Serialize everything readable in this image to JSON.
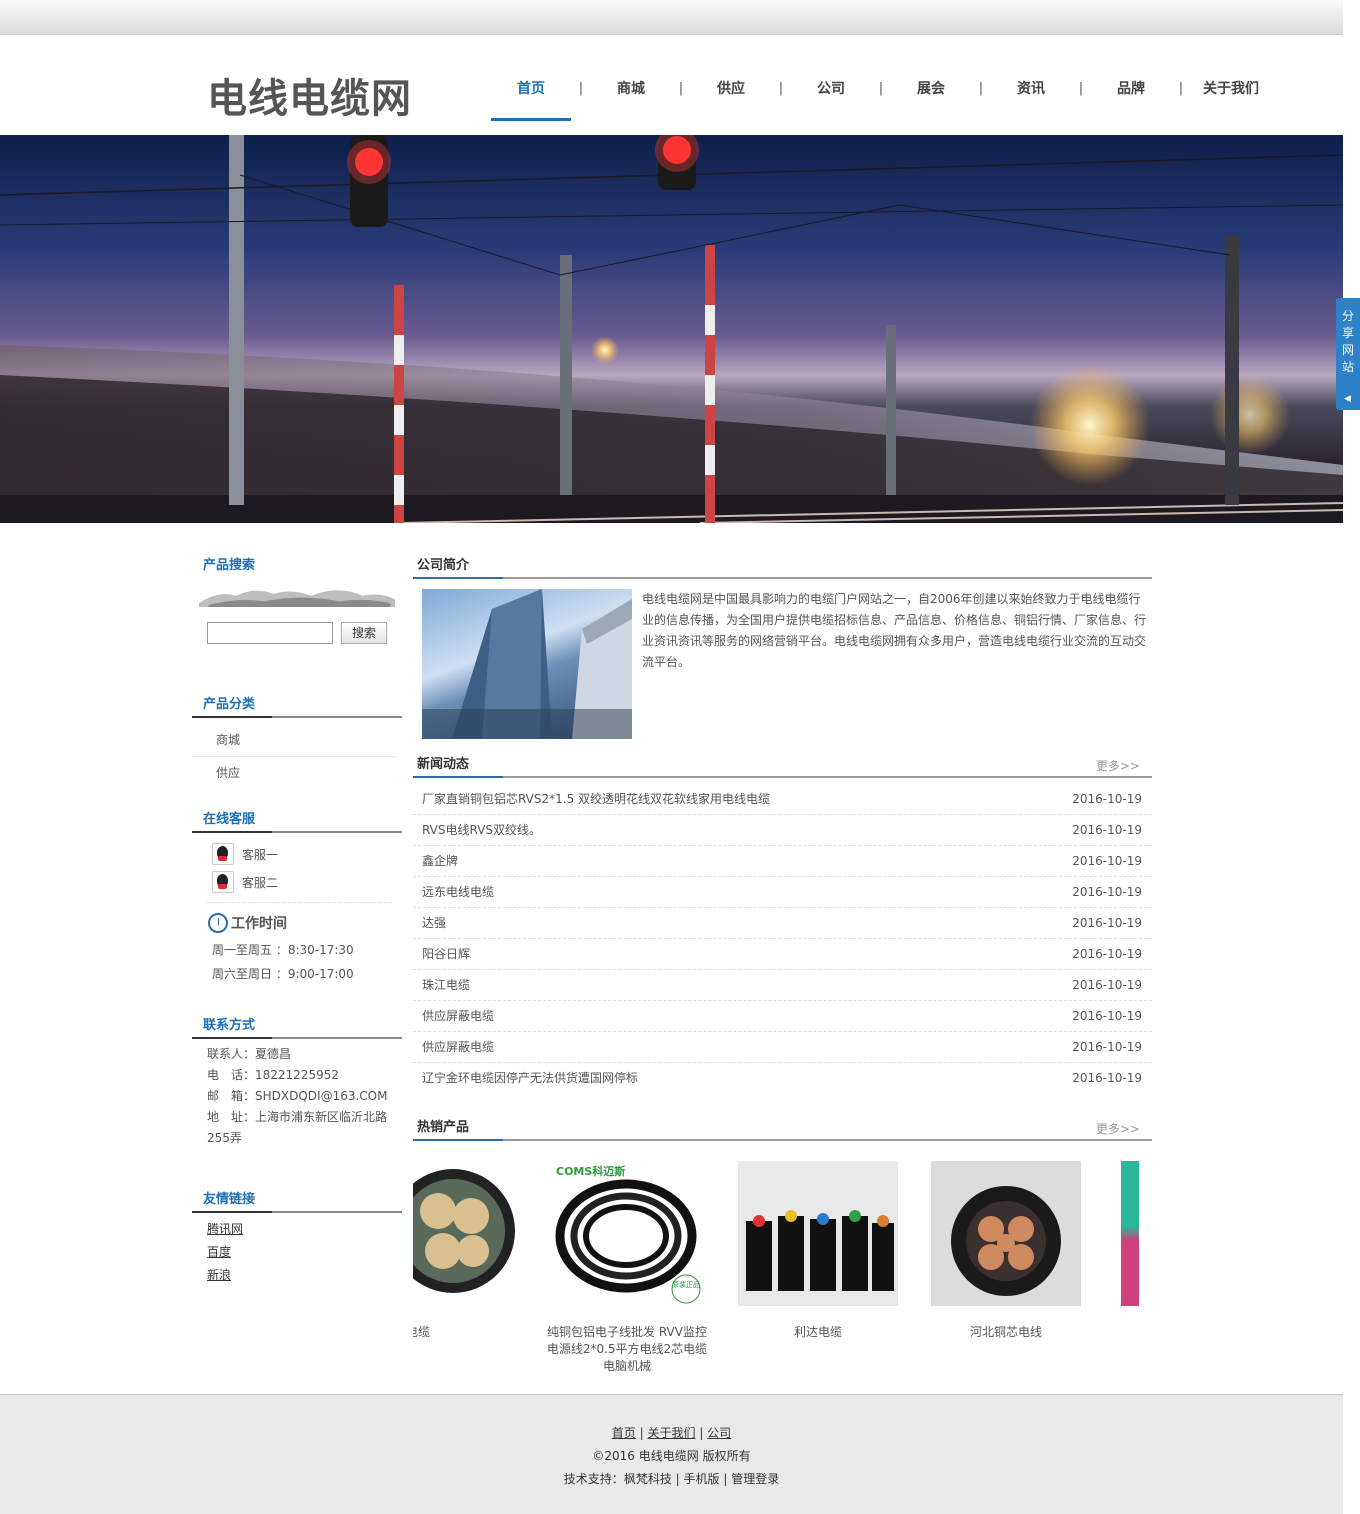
{
  "site": {
    "logo": "电线电缆网"
  },
  "nav": {
    "items": [
      "首页",
      "商城",
      "供应",
      "公司",
      "展会",
      "资讯",
      "品牌",
      "关于我们"
    ],
    "separator": "|",
    "active": "首页"
  },
  "share": {
    "label": "分享网站",
    "arrow": "◀"
  },
  "sidebar": {
    "search": {
      "title": "产品搜索",
      "button": "搜索",
      "value": ""
    },
    "categories": {
      "title": "产品分类",
      "items": [
        "商城",
        "供应"
      ]
    },
    "service": {
      "title": "在线客服",
      "agents": [
        "客服一",
        "客服二"
      ]
    },
    "work": {
      "title": "工作时间",
      "lines": [
        "周一至周五 ：8:30-17:30",
        "周六至周日 ：9:00-17:00"
      ]
    },
    "contact": {
      "title": "联系方式",
      "lines": [
        "联系人：夏德昌",
        "电　话：18221225952",
        "邮　箱：SHDXDQDI@163.COM",
        "地　址：上海市浦东新区临沂北路255弄"
      ]
    },
    "links": {
      "title": "友情链接",
      "items": [
        "腾讯网",
        "百度",
        "新浪"
      ]
    }
  },
  "intro": {
    "title": "公司简介",
    "text": "电线电缆网是中国最具影响力的电缆门户网站之一，自2006年创建以来始终致力于电线电缆行业的信息传播，为全国用户提供电缆招标信息、产品信息、价格信息、铜铝行情、厂家信息、行业资讯资讯等服务的网络营销平台。电线电缆网拥有众多用户，营造电线电缆行业交流的互动交流平台。"
  },
  "news": {
    "title": "新闻动态",
    "more": "更多>>",
    "items": [
      {
        "title": "厂家直销铜包铝芯RVS2*1.5 双绞透明花线双花软线家用电线电缆",
        "date": "2016-10-19"
      },
      {
        "title": "RVS电线RVS双绞线。",
        "date": "2016-10-19"
      },
      {
        "title": "鑫企牌",
        "date": "2016-10-19"
      },
      {
        "title": "远东电线电缆",
        "date": "2016-10-19"
      },
      {
        "title": "达强",
        "date": "2016-10-19"
      },
      {
        "title": "阳谷日辉",
        "date": "2016-10-19"
      },
      {
        "title": "珠江电缆",
        "date": "2016-10-19"
      },
      {
        "title": "供应屏蔽电缆",
        "date": "2016-10-19"
      },
      {
        "title": "供应屏蔽电缆",
        "date": "2016-10-19"
      },
      {
        "title": "辽宁金环电缆因停产无法供货遭国网停标",
        "date": "2016-10-19"
      }
    ]
  },
  "products": {
    "title": "热销产品",
    "more": "更多>>",
    "items": [
      "珠江电缆",
      "纯铜包铝电子线批发 RVV监控电源线2*0.5平方电线2芯电缆电脑机械",
      "利达电缆",
      "河北铜芯电线"
    ],
    "badge": "原装正品",
    "brand": "COMS科迈斯"
  },
  "footer": {
    "links": [
      "首页",
      "关于我们",
      "公司"
    ],
    "copyright": "©2016 电线电缆网  版权所有",
    "support_prefix": "技术支持：",
    "support_items": [
      "枫梵科技",
      "手机版",
      "管理登录"
    ]
  }
}
